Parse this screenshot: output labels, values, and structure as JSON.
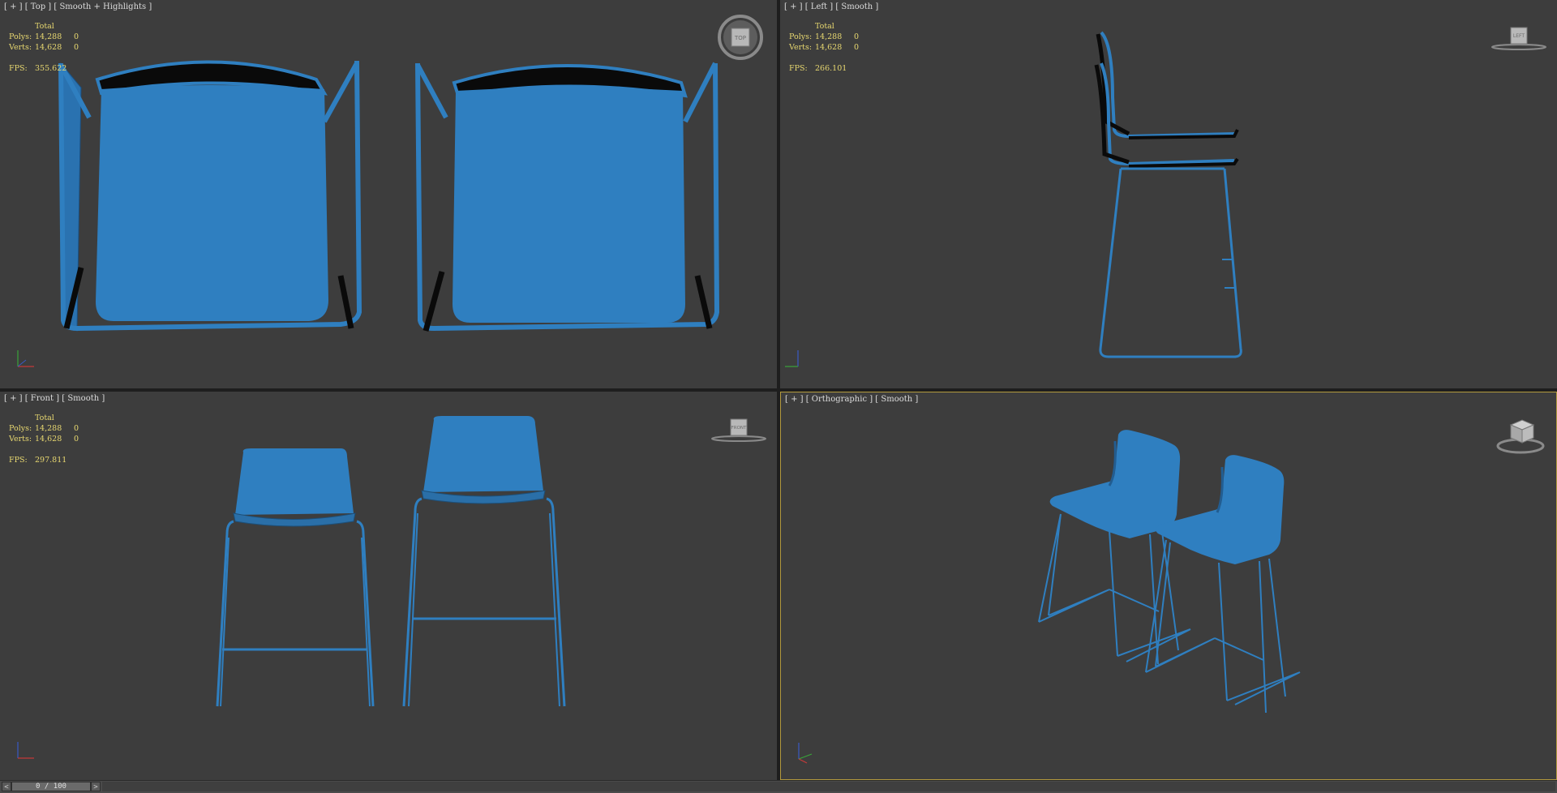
{
  "viewports": {
    "top": {
      "label": "[ + ] [ Top ] [ Smooth + Highlights ]",
      "fps": "355.622"
    },
    "left": {
      "label": "[ + ] [ Left ] [ Smooth ]",
      "fps": "266.101"
    },
    "front": {
      "label": "[ + ] [ Front ] [ Smooth ]",
      "fps": "297.811"
    },
    "ortho": {
      "label": "[ + ] [ Orthographic ] [ Smooth ]"
    }
  },
  "stats": {
    "header": "Total",
    "polys_label": "Polys:",
    "polys_value": "14,288",
    "polys_sel": "0",
    "verts_label": "Verts:",
    "verts_value": "14,628",
    "verts_sel": "0",
    "fps_label": "FPS:"
  },
  "viewcube": {
    "top": "TOP",
    "left": "LEFT",
    "front": "FRONT"
  },
  "timeline": {
    "prev": "<",
    "next": ">",
    "frame": "0 / 100"
  },
  "colors": {
    "viewport_bg": "#3d3d3d",
    "chair_blue": "#2f7fc0",
    "stats_text": "#e8d870",
    "active_border": "#b39a3e"
  }
}
